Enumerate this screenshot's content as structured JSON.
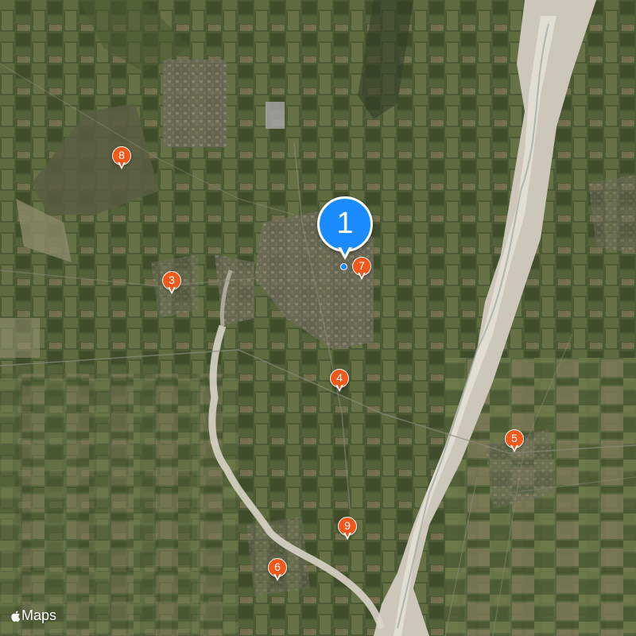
{
  "map": {
    "type": "satellite",
    "markers": [
      {
        "label": "1",
        "color": "#1a8cff",
        "style": "large-balloon"
      },
      {
        "label": "7",
        "color": "#f0581c"
      },
      {
        "label": "8",
        "color": "#f0581c"
      },
      {
        "label": "3",
        "color": "#f0581c"
      },
      {
        "label": "4",
        "color": "#f0581c"
      },
      {
        "label": "5",
        "color": "#f0581c"
      },
      {
        "label": "9",
        "color": "#f0581c"
      },
      {
        "label": "6",
        "color": "#f0581c"
      }
    ]
  },
  "attribution": {
    "brand_icon": "apple-logo",
    "text": "Maps"
  }
}
